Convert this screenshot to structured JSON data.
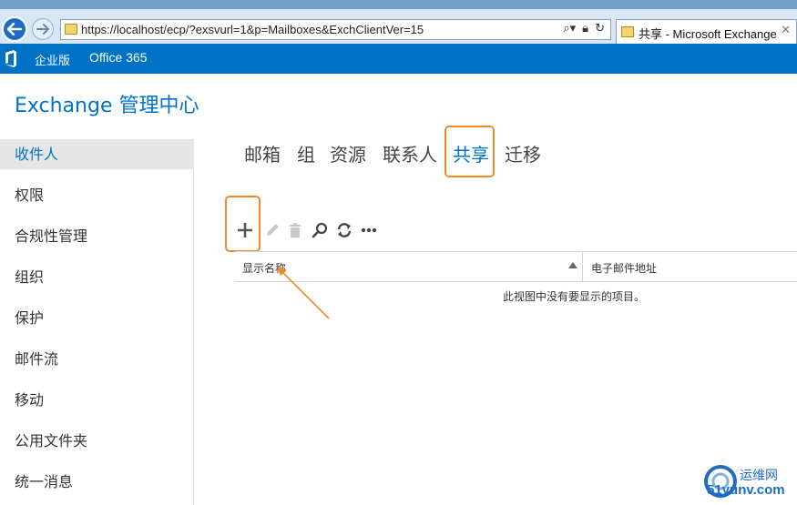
{
  "browser": {
    "url": "https://localhost/ecp/?exsvurl=1&p=Mailboxes&ExchClientVer=15",
    "tab_title": "共享 - Microsoft Exchange",
    "back_icon": "back-arrow-icon",
    "forward_icon": "forward-arrow-icon"
  },
  "header": {
    "brand_icon": "office-logo-icon",
    "links": [
      "企业版",
      "Office 365"
    ]
  },
  "app_title": "Exchange 管理中心",
  "sidebar": {
    "items": [
      {
        "label": "收件人",
        "selected": true
      },
      {
        "label": "权限"
      },
      {
        "label": "合规性管理"
      },
      {
        "label": "组织"
      },
      {
        "label": "保护"
      },
      {
        "label": "邮件流"
      },
      {
        "label": "移动"
      },
      {
        "label": "公用文件夹"
      },
      {
        "label": "统一消息"
      }
    ]
  },
  "tabs": [
    {
      "label": "邮箱"
    },
    {
      "label": "组"
    },
    {
      "label": "资源"
    },
    {
      "label": "联系人"
    },
    {
      "label": "共享",
      "active": true
    },
    {
      "label": "迁移"
    }
  ],
  "toolbar": {
    "icons": [
      "add-icon",
      "edit-icon",
      "delete-icon",
      "search-icon",
      "refresh-icon",
      "more-icon"
    ]
  },
  "table": {
    "columns": [
      "显示名称",
      "电子邮件地址"
    ],
    "empty_message": "此视图中没有要显示的项目。"
  },
  "watermark": {
    "line1": "运维网",
    "line2": "51yunv.com"
  },
  "colors": {
    "accent": "#0072c6",
    "highlight": "#f08a24"
  }
}
